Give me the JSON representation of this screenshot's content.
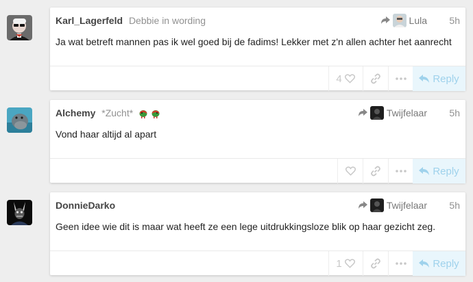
{
  "posts": [
    {
      "username": "Karl_Lagerfeld",
      "user_title": "Debbie in wording",
      "reply_to": "Lula",
      "time": "5h",
      "body": "Ja wat betreft mannen pas ik wel goed bij de fadims! Lekker met z'n allen achter het aanrecht",
      "like_count": "4",
      "reply_label": "Reply"
    },
    {
      "username": "Alchemy",
      "user_title": "*Zucht*",
      "reply_to": "Twijfelaar",
      "time": "5h",
      "body": "Vond haar altijd al apart",
      "like_count": "",
      "reply_label": "Reply"
    },
    {
      "username": "DonnieDarko",
      "user_title": "",
      "reply_to": "Twijfelaar",
      "time": "5h",
      "body": "Geen idee wie dit is maar wat heeft ze een lege uitdrukkingsloze blik op haar gezicht zeg.",
      "like_count": "1",
      "reply_label": "Reply"
    }
  ],
  "colors": {
    "accent_reply": "#9fd2ec",
    "reply_bg": "#e9f6fc",
    "page_bg": "#eeeeee"
  },
  "icons": [
    "reply-arrow-icon",
    "heart-icon",
    "link-icon",
    "more-icon",
    "reply-icon",
    "parrot-emoji-icon"
  ]
}
